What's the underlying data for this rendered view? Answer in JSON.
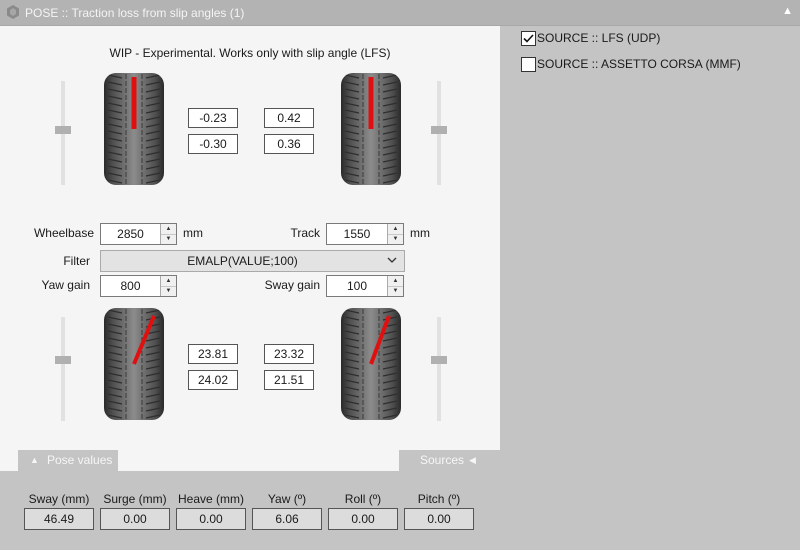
{
  "window": {
    "title": "POSE :: Traction loss from slip angles (1)",
    "icon": "cog-icon",
    "collapse_icon": "triangle-up-icon"
  },
  "caption": "WIP - Experimental. Works only with slip angle (LFS)",
  "front": {
    "left_values": [
      "-0.23",
      "-0.30"
    ],
    "right_values": [
      "0.42",
      "0.36"
    ]
  },
  "rear": {
    "left_values": [
      "23.81",
      "24.02"
    ],
    "right_values": [
      "23.32",
      "21.51"
    ]
  },
  "wheelbase": {
    "label": "Wheelbase",
    "value": "2850",
    "unit": "mm"
  },
  "track": {
    "label": "Track",
    "value": "1550",
    "unit": "mm"
  },
  "filter": {
    "label": "Filter",
    "value": "EMALP(VALUE;100)"
  },
  "yaw_gain": {
    "label": "Yaw gain",
    "value": "800"
  },
  "sway_gain": {
    "label": "Sway gain",
    "value": "100"
  },
  "tabs": {
    "pose_values": "Pose values",
    "sources": "Sources"
  },
  "pose_values": [
    {
      "label": "Sway (mm)",
      "value": "46.49"
    },
    {
      "label": "Surge (mm)",
      "value": "0.00"
    },
    {
      "label": "Heave (mm)",
      "value": "0.00"
    },
    {
      "label": "Yaw (º)",
      "value": "6.06"
    },
    {
      "label": "Roll (º)",
      "value": "0.00"
    },
    {
      "label": "Pitch (º)",
      "value": "0.00"
    }
  ],
  "sources": [
    {
      "label": "SOURCE :: LFS (UDP)",
      "checked": true
    },
    {
      "label": "SOURCE :: ASSETTO CORSA (MMF)",
      "checked": false
    }
  ],
  "colors": {
    "slip_indicator": "#e01010",
    "panel": "#f5f5f5",
    "background": "#c4c4c4"
  }
}
